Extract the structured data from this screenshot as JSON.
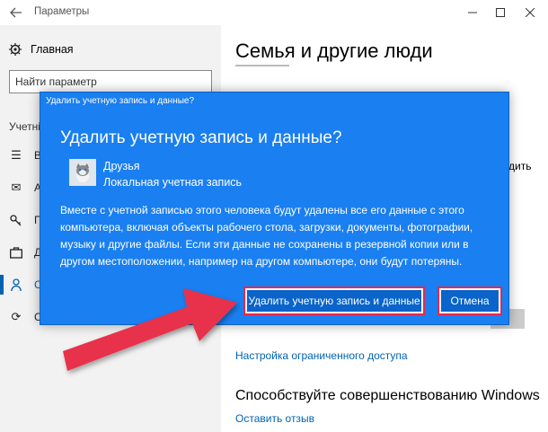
{
  "window": {
    "title": "Параметры",
    "back_icon": "arrow-left-icon",
    "controls": [
      "minimize-icon",
      "maximize-icon",
      "close-icon"
    ]
  },
  "sidebar": {
    "home_label": "Главная",
    "search_placeholder": "Найти параметр",
    "heading": "Учетні",
    "items": [
      {
        "icon": "person-list-icon",
        "label": "Ва"
      },
      {
        "icon": "mail-icon",
        "label": "А"
      },
      {
        "icon": "key-icon",
        "label": "П"
      },
      {
        "icon": "briefcase-icon",
        "label": "Д"
      },
      {
        "icon": "person-icon",
        "label": "Се",
        "active": true
      },
      {
        "icon": "sync-icon",
        "label": "Си"
      }
    ]
  },
  "main": {
    "title": "Семья и другие люди",
    "right_fragment": "дить",
    "restricted_link": "Настройка ограниченного доступа",
    "improve_title": "Способствуйте совершенствованию Windows",
    "feedback_link": "Оставить отзыв"
  },
  "dialog": {
    "caption": "Удалить учетную запись и данные?",
    "heading": "Удалить учетную запись и данные?",
    "account_name": "Друзья",
    "account_type": "Локальная учетная запись",
    "body": "Вместе с учетной записью этого человека будут удалены все его данные с этого компьютера, включая объекты рабочего стола, загрузки, документы, фотографии, музыку и другие файлы. Если эти данные не сохранены в резервной копии или в другом местоположении, например на другом компьютере, они будут потеряны.",
    "delete_button": "Удалить учетную запись и данные",
    "cancel_button": "Отмена"
  },
  "colors": {
    "dialog_bg": "#1a7ff0",
    "button_bg": "#0a64c9",
    "accent": "#0063b1",
    "highlight": "#e6284e",
    "arrow": "#e8334b"
  }
}
